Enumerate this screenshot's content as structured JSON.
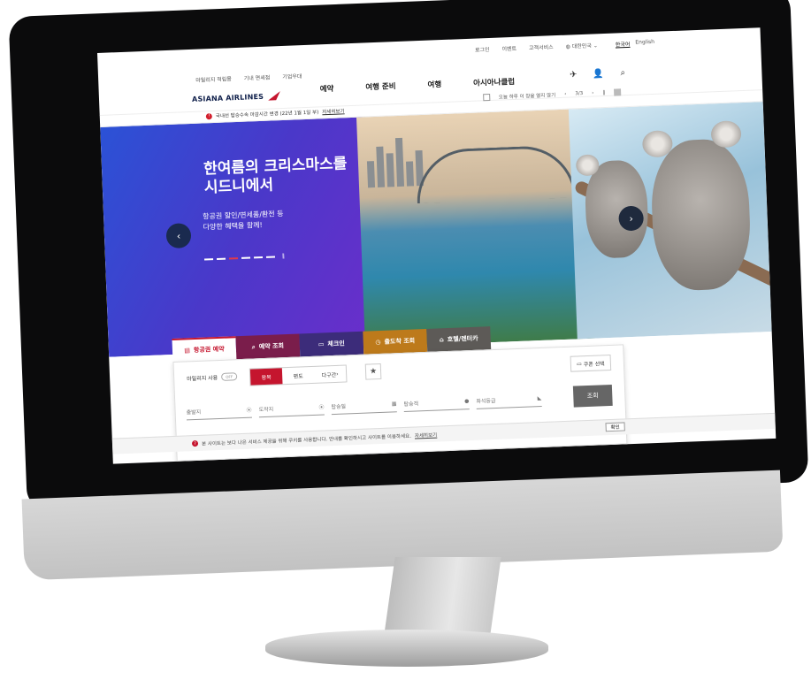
{
  "util_left": [
    "마일리지 적립몰",
    "기내 면세점",
    "기업우대"
  ],
  "util_right": [
    "로그인",
    "이벤트",
    "고객서비스",
    "대한민국"
  ],
  "lang": [
    "한국어",
    "English"
  ],
  "logo_text": "ASIANA AIRLINES",
  "nav": [
    "예약",
    "여행 준비",
    "여행",
    "아시아나클럽"
  ],
  "notice": {
    "icon": "!",
    "text": "국내선 탑승수속 마감시간 변경 (22년 1월 1일 부)",
    "more": "자세히보기"
  },
  "today": {
    "label": "오늘 하루 이 창을 열지 않기",
    "page": "3/3"
  },
  "hero": {
    "title_line1": "한여름의 크리스마스를",
    "title_line2": "시드니에서",
    "sub_line1": "항공권 할인/면세품/환전 등",
    "sub_line2": "다양한 혜택을 함께!"
  },
  "tabs": [
    "항공권 예약",
    "예약 조회",
    "체크인",
    "출도착 조회",
    "호텔/렌터카"
  ],
  "booking": {
    "mileage": "마일리지 사용",
    "toggle": "OFF",
    "trip": [
      "왕복",
      "편도",
      "다구간"
    ],
    "coupon": "쿠폰 선택",
    "fields": [
      "출발지",
      "도착지",
      "탑승일",
      "탑승객",
      "좌석등급"
    ],
    "search": "조회"
  },
  "cookie": {
    "icon": "?",
    "text": "본 사이트는 보다 나은 서비스 제공을 위해 쿠키를 사용합니다. 안내를 확인하시고 사이트를 이용하세요.",
    "more": "자세히보기",
    "confirm": "확인"
  },
  "colors": {
    "brand": "#c5152e",
    "navy": "#0f1f4a"
  }
}
